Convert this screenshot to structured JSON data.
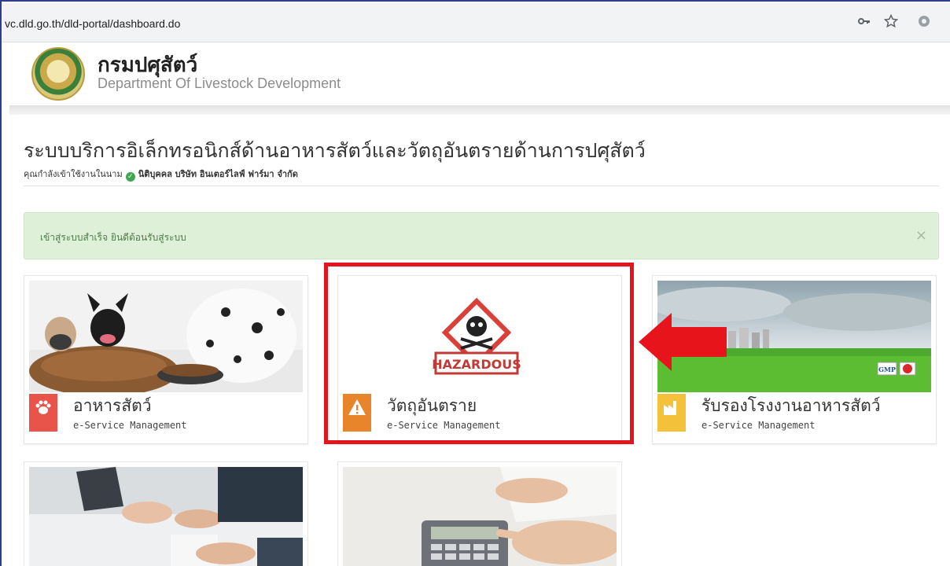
{
  "browser": {
    "url": "vc.dld.go.th/dld-portal/dashboard.do",
    "icons": [
      "key-icon",
      "star-icon",
      "extension-icon"
    ]
  },
  "header": {
    "title": "กรมปศุสัตว์",
    "subtitle": "Department Of Livestock Development"
  },
  "page": {
    "title": "ระบบบริการอิเล็กทรอนิกส์ด้านอาหารสัตว์และวัตถุอันตรายด้านการปศุสัตว์",
    "user_prefix": "คุณกำลังเข้าใช้งานในนาม",
    "user_org": "นิติบุคคล บริษัท อินเตอร์ไลฟ์ ฟาร์มา จำกัด"
  },
  "alert": {
    "text": "เข้าสู่ระบบสำเร็จ ยินดีต้อนรับสู่ระบบ",
    "close": "×"
  },
  "cards": [
    {
      "title": "อาหารสัตว์",
      "subtitle": "e-Service Management",
      "icon": "paw-icon",
      "color": "#e8534a"
    },
    {
      "title": "วัตถุอันตราย",
      "subtitle": "e-Service Management",
      "icon": "warning-icon",
      "color": "#e8852a",
      "image_text": "HAZARDOUS"
    },
    {
      "title": "รับรองโรงงานอาหารสัตว์",
      "subtitle": "e-Service Management",
      "icon": "factory-icon",
      "color": "#f3c13a",
      "image_text": "GMP"
    }
  ],
  "colors": {
    "highlight": "#e3141c",
    "alert_bg": "#dff0d8"
  }
}
